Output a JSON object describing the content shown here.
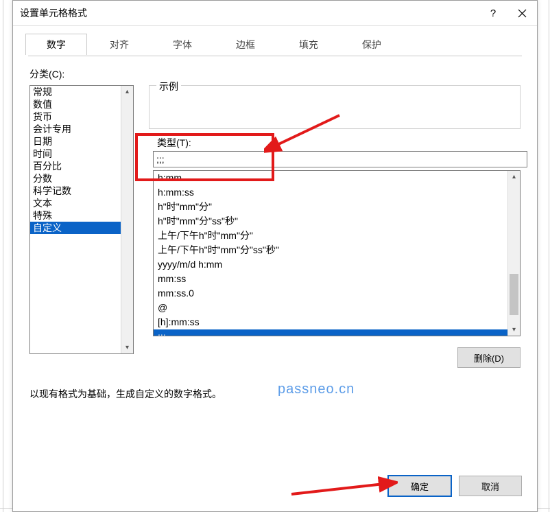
{
  "dialog": {
    "title": "设置单元格格式",
    "help": "?",
    "tabs": [
      "数字",
      "对齐",
      "字体",
      "边框",
      "填充",
      "保护"
    ],
    "active_tab_index": 0
  },
  "number_tab": {
    "category_label": "分类(C):",
    "categories": [
      "常规",
      "数值",
      "货币",
      "会计专用",
      "日期",
      "时间",
      "百分比",
      "分数",
      "科学记数",
      "文本",
      "特殊",
      "自定义"
    ],
    "selected_category_index": 11,
    "example_label": "示例",
    "type_label": "类型(T):",
    "type_value": ";;;",
    "format_list": [
      "h:mm",
      "h:mm:ss",
      "h\"时\"mm\"分\"",
      "h\"时\"mm\"分\"ss\"秒\"",
      "上午/下午h\"时\"mm\"分\"",
      "上午/下午h\"时\"mm\"分\"ss\"秒\"",
      "yyyy/m/d h:mm",
      "mm:ss",
      "mm:ss.0",
      "@",
      "[h]:mm:ss",
      ";;;"
    ],
    "selected_format_index": 11,
    "delete_label": "删除(D)",
    "hint": "以现有格式为基础，生成自定义的数字格式。"
  },
  "watermark": "passneo.cn",
  "footer": {
    "ok": "确定",
    "cancel": "取消"
  },
  "icons": {
    "scroll_up": "▴",
    "scroll_down": "▾"
  }
}
